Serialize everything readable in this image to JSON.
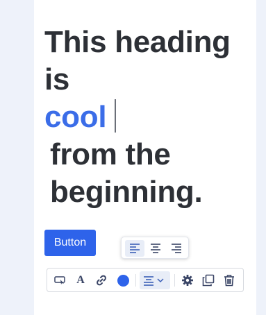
{
  "heading": {
    "line1": "This heading",
    "line2": "is",
    "highlight": "cool",
    "line4": "from the",
    "line5": "beginning."
  },
  "button": {
    "label": "Button"
  },
  "colors": {
    "accent": "#2e63ea",
    "highlight_text": "#3b6de8",
    "heading_text": "#2d3036",
    "page_bg": "#eef2fa",
    "icon": "#3a4566"
  },
  "align_popover": {
    "options": [
      "align-left-icon",
      "align-center-icon",
      "align-right-icon"
    ],
    "selected": "align-left-icon"
  },
  "toolbar": {
    "items": [
      "link-style-icon",
      "font-icon",
      "link-icon",
      "color-picker",
      "align-center-icon",
      "chevron-down-icon",
      "gear-icon",
      "duplicate-icon",
      "trash-icon"
    ],
    "font_glyph": "A",
    "text_color": "#2e63ea"
  }
}
